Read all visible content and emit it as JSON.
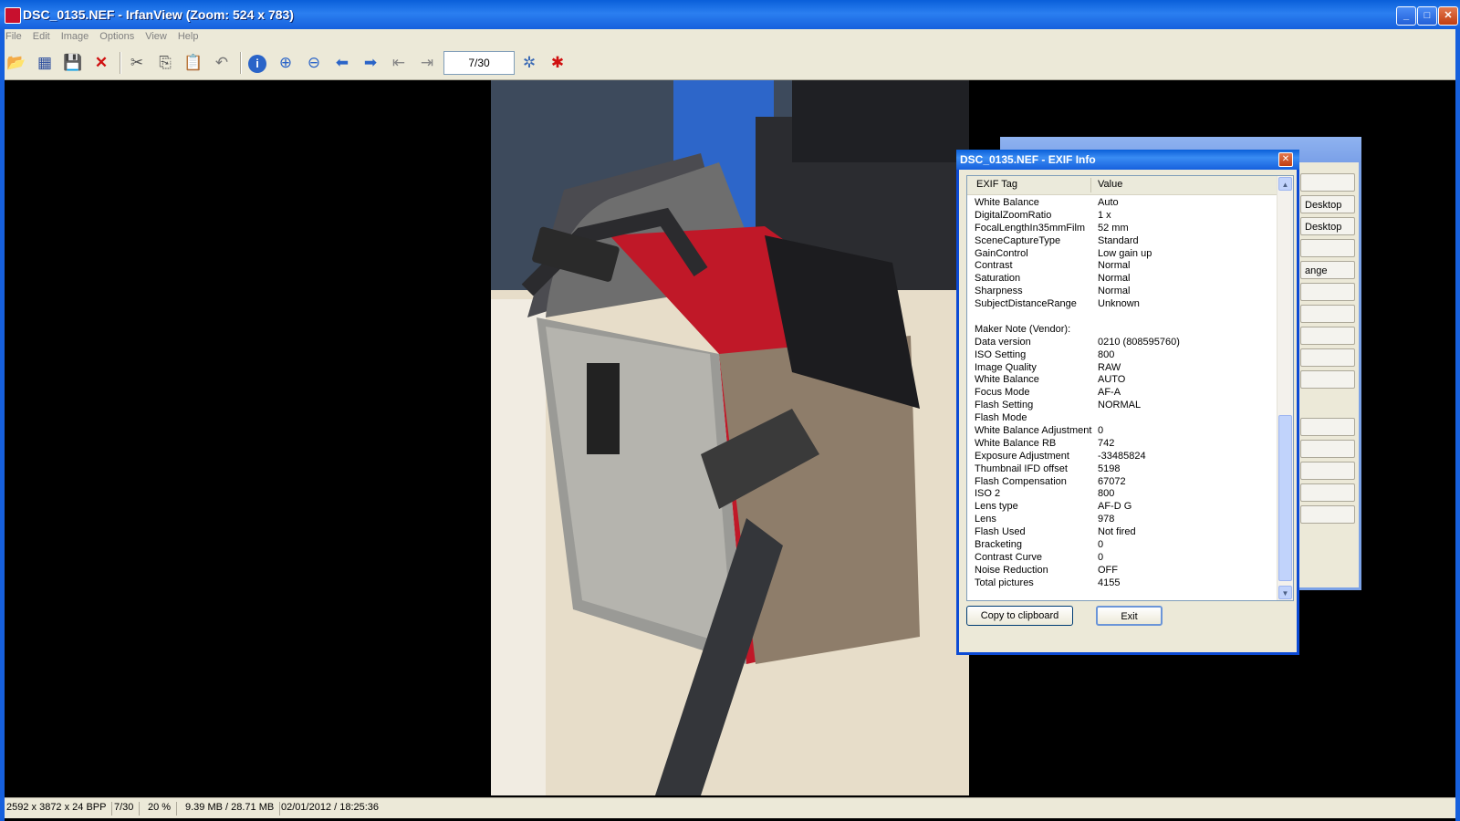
{
  "window": {
    "title": "DSC_0135.NEF - IrfanView (Zoom: 524 x 783)",
    "minimize_icon": "minimize-icon",
    "maximize_icon": "maximize-icon",
    "close_icon": "close-icon"
  },
  "menu": [
    "File",
    "Edit",
    "Image",
    "Options",
    "View",
    "Help"
  ],
  "toolbar": {
    "page_counter": "7/30",
    "icons": [
      "open-folder-icon",
      "thumbnails-icon",
      "save-icon",
      "delete-icon",
      "cut-icon",
      "copy-icon",
      "paste-icon",
      "undo-icon",
      "info-icon",
      "zoom-in-icon",
      "zoom-out-icon",
      "previous-icon",
      "next-icon",
      "first-page-icon",
      "last-page-icon",
      "settings-icon",
      "irfanview-logo-icon"
    ]
  },
  "exif_dialog": {
    "title": "DSC_0135.NEF - EXIF Info",
    "col_tag": "EXIF Tag",
    "col_value": "Value",
    "rows": [
      {
        "tag": "White Balance",
        "value": "Auto"
      },
      {
        "tag": "DigitalZoomRatio",
        "value": "1 x"
      },
      {
        "tag": "FocalLengthIn35mmFilm",
        "value": "52 mm"
      },
      {
        "tag": "SceneCaptureType",
        "value": "Standard"
      },
      {
        "tag": "GainControl",
        "value": "Low gain up"
      },
      {
        "tag": "Contrast",
        "value": "Normal"
      },
      {
        "tag": "Saturation",
        "value": "Normal"
      },
      {
        "tag": "Sharpness",
        "value": "Normal"
      },
      {
        "tag": "SubjectDistanceRange",
        "value": "Unknown"
      },
      {
        "tag": "",
        "value": ""
      },
      {
        "tag": "Maker Note (Vendor):",
        "value": ""
      },
      {
        "tag": "Data version",
        "value": "0210 (808595760)"
      },
      {
        "tag": "ISO Setting",
        "value": "800"
      },
      {
        "tag": "Image Quality",
        "value": "RAW"
      },
      {
        "tag": "White Balance",
        "value": "AUTO"
      },
      {
        "tag": "Focus Mode",
        "value": "AF-A"
      },
      {
        "tag": "Flash Setting",
        "value": "NORMAL"
      },
      {
        "tag": "Flash Mode",
        "value": ""
      },
      {
        "tag": "White Balance Adjustment",
        "value": "0"
      },
      {
        "tag": "White Balance RB",
        "value": "742"
      },
      {
        "tag": "Exposure Adjustment",
        "value": "-33485824"
      },
      {
        "tag": "Thumbnail IFD offset",
        "value": "5198"
      },
      {
        "tag": "Flash Compensation",
        "value": "67072"
      },
      {
        "tag": "ISO 2",
        "value": "800"
      },
      {
        "tag": "Lens type",
        "value": "AF-D G"
      },
      {
        "tag": "Lens",
        "value": "978"
      },
      {
        "tag": "Flash Used",
        "value": "Not fired"
      },
      {
        "tag": "Bracketing",
        "value": "0"
      },
      {
        "tag": "Contrast Curve",
        "value": "0"
      },
      {
        "tag": "Noise Reduction",
        "value": "OFF"
      },
      {
        "tag": "Total pictures",
        "value": "4155"
      }
    ],
    "copy_button": "Copy to clipboard",
    "exit_button": "Exit"
  },
  "background_dialog": {
    "buttons": [
      "",
      "Desktop",
      "Desktop",
      "",
      "ange",
      "",
      "",
      "",
      "",
      "",
      "",
      "",
      "",
      "",
      "",
      ""
    ]
  },
  "status": {
    "dimensions": "2592 x 3872 x 24 BPP",
    "index": "7/30",
    "zoom": "20 %",
    "size": "9.39 MB / 28.71 MB",
    "datetime": "02/01/2012 / 18:25:36"
  }
}
